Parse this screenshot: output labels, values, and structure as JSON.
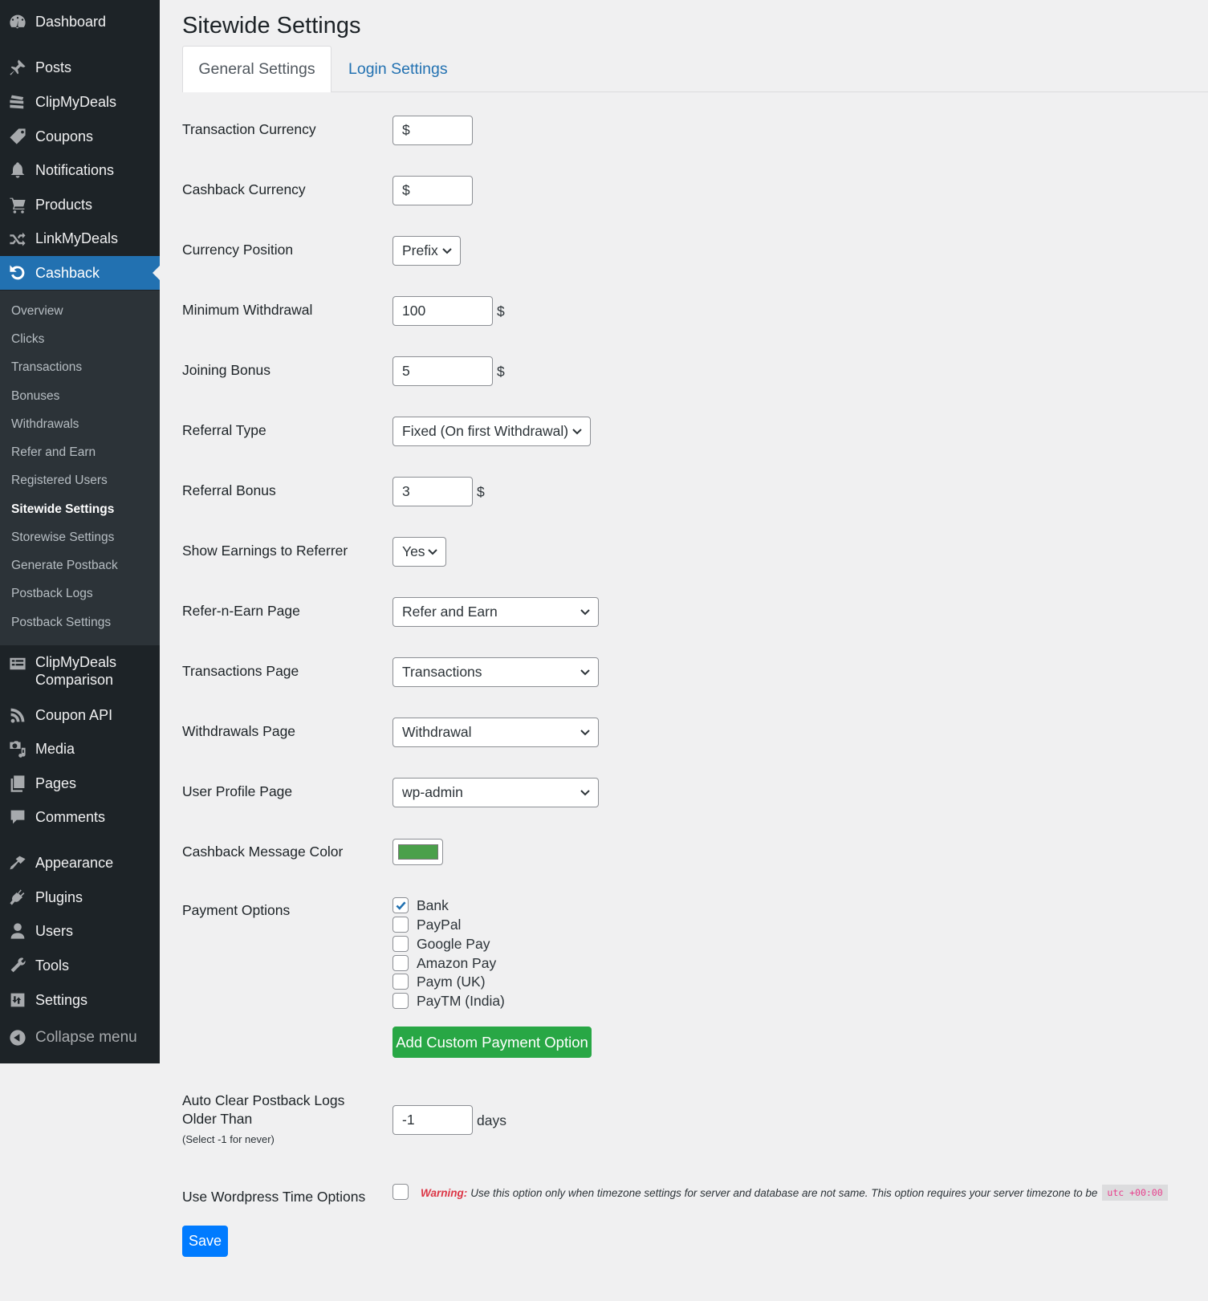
{
  "sidebar": {
    "items": [
      {
        "label": "Dashboard",
        "icon": "dashboard-icon"
      },
      {
        "label": "Posts",
        "icon": "pin-icon"
      },
      {
        "label": "ClipMyDeals",
        "icon": "tickets-icon"
      },
      {
        "label": "Coupons",
        "icon": "tag-icon"
      },
      {
        "label": "Notifications",
        "icon": "bell-icon"
      },
      {
        "label": "Products",
        "icon": "cart-icon"
      },
      {
        "label": "LinkMyDeals",
        "icon": "shuffle-icon"
      },
      {
        "label": "Cashback",
        "icon": "undo-icon"
      },
      {
        "label": "ClipMyDeals",
        "label2": "Comparison",
        "icon": "table-icon"
      },
      {
        "label": "Coupon API",
        "icon": "rss-icon"
      },
      {
        "label": "Media",
        "icon": "media-icon"
      },
      {
        "label": "Pages",
        "icon": "pages-icon"
      },
      {
        "label": "Comments",
        "icon": "comment-icon"
      },
      {
        "label": "Appearance",
        "icon": "brush-icon"
      },
      {
        "label": "Plugins",
        "icon": "plugin-icon"
      },
      {
        "label": "Users",
        "icon": "user-icon"
      },
      {
        "label": "Tools",
        "icon": "wrench-icon"
      },
      {
        "label": "Settings",
        "icon": "settings-icon"
      }
    ],
    "submenu": [
      "Overview",
      "Clicks",
      "Transactions",
      "Bonuses",
      "Withdrawals",
      "Refer and Earn",
      "Registered Users",
      "Sitewide Settings",
      "Storewise Settings",
      "Generate Postback",
      "Postback Logs",
      "Postback Settings"
    ],
    "current_submenu": "Sitewide Settings",
    "collapse_label": "Collapse menu"
  },
  "page": {
    "title": "Sitewide Settings",
    "tabs": [
      {
        "label": "General Settings",
        "active": true
      },
      {
        "label": "Login Settings",
        "active": false
      }
    ]
  },
  "form": {
    "transaction_currency": {
      "label": "Transaction Currency",
      "value": "$"
    },
    "cashback_currency": {
      "label": "Cashback Currency",
      "value": "$"
    },
    "currency_position": {
      "label": "Currency Position",
      "value": "Prefix"
    },
    "minimum_withdrawal": {
      "label": "Minimum Withdrawal",
      "value": "100",
      "suffix": "$"
    },
    "joining_bonus": {
      "label": "Joining Bonus",
      "value": "5",
      "suffix": "$"
    },
    "referral_type": {
      "label": "Referral Type",
      "value": "Fixed (On first Withdrawal)"
    },
    "referral_bonus": {
      "label": "Referral Bonus",
      "value": "3",
      "suffix": "$"
    },
    "show_earnings": {
      "label": "Show Earnings to Referrer",
      "value": "Yes"
    },
    "refer_page": {
      "label": "Refer-n-Earn Page",
      "value": "Refer and Earn"
    },
    "transactions_page": {
      "label": "Transactions Page",
      "value": "Transactions"
    },
    "withdrawals_page": {
      "label": "Withdrawals Page",
      "value": "Withdrawal"
    },
    "profile_page": {
      "label": "User Profile Page",
      "value": "wp-admin"
    },
    "message_color": {
      "label": "Cashback Message Color",
      "value": "#4aa04a"
    },
    "payment_options": {
      "label": "Payment Options",
      "options": [
        {
          "label": "Bank",
          "checked": true
        },
        {
          "label": "PayPal",
          "checked": false
        },
        {
          "label": "Google Pay",
          "checked": false
        },
        {
          "label": "Amazon Pay",
          "checked": false
        },
        {
          "label": "Paym (UK)",
          "checked": false
        },
        {
          "label": "PayTM (India)",
          "checked": false
        }
      ],
      "add_button": "Add Custom Payment Option"
    },
    "auto_clear": {
      "label_line1": "Auto Clear Postback Logs",
      "label_line2": "Older Than",
      "hint": "(Select -1 for never)",
      "value": "-1",
      "suffix": "days"
    },
    "wp_time": {
      "label": "Use Wordpress Time Options",
      "checked": false,
      "warning_label": "Warning:",
      "warning_text": "Use this option only when timezone settings for server and database are not same. This option requires your server timezone to be",
      "code": "utc +00:00"
    },
    "save_label": "Save"
  }
}
